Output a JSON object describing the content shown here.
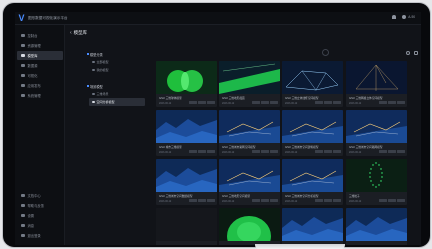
{
  "app": {
    "title": "图形数据可视化演示平台",
    "logo_glyph": "V",
    "user_name": "A-90"
  },
  "sidebar": {
    "items": [
      {
        "label": "控制台",
        "active": false
      },
      {
        "label": "资源管理",
        "active": false
      },
      {
        "label": "模型库",
        "active": true
      },
      {
        "label": "数据源",
        "active": false
      },
      {
        "label": "可视化",
        "active": false
      },
      {
        "label": "应用发布",
        "active": false
      },
      {
        "label": "系统管理",
        "active": false
      }
    ],
    "bottom_items": [
      {
        "label": "文档中心"
      },
      {
        "label": "帮助与反馈"
      },
      {
        "label": "设置"
      },
      {
        "label": "消息"
      },
      {
        "label": "退出登录"
      }
    ]
  },
  "page": {
    "title": "模型库",
    "back_glyph": "‹"
  },
  "categories": {
    "group1_title": "模型分类",
    "group1_items": [
      "全部模型",
      "我的模型"
    ],
    "group2_title": "场景模型",
    "group2_items": [
      {
        "label": "三维场景",
        "active": false
      },
      {
        "label": "空间分析模型",
        "active": true
      }
    ]
  },
  "cards": [
    {
      "title": "GSU 三维球体模型",
      "meta": "2023-06-12",
      "thumb": "green-spheres"
    },
    {
      "title": "GSU 三维地形截面",
      "meta": "2023-06-12",
      "thumb": "green-plane"
    },
    {
      "title": "GSU 三维立体线框空间模型",
      "meta": "2023-06-12",
      "thumb": "wire-box"
    },
    {
      "title": "GSU 三维网格立体空间模型",
      "meta": "2023-06-12",
      "thumb": "wire-star"
    },
    {
      "title": "GSU 城市三维模型",
      "meta": "2023-06-12",
      "thumb": "blue-terrain"
    },
    {
      "title": "GSU 三维城市路网空间模型",
      "meta": "2023-06-12",
      "thumb": "blue-lines"
    },
    {
      "title": "GSU 三维城市空间建筑模型",
      "meta": "2023-06-12",
      "thumb": "blue-lines"
    },
    {
      "title": "GSU 三维城市空间路网模型",
      "meta": "2023-06-12",
      "thumb": "blue-lines"
    },
    {
      "title": "GSU 三维城市空间数据模型",
      "meta": "2023-06-12",
      "thumb": "blue-terrain"
    },
    {
      "title": "GSU 三维地形空间模型",
      "meta": "2023-06-12",
      "thumb": "blue-lines"
    },
    {
      "title": "GSU 三维城市空间分析模型",
      "meta": "2023-06-12",
      "thumb": "blue-lines"
    },
    {
      "title": "三维粒子",
      "meta": "2023-06-12",
      "thumb": "green-dots"
    },
    {
      "title": "",
      "meta": "",
      "thumb": "dark"
    },
    {
      "title": "",
      "meta": "",
      "thumb": "green-dome"
    },
    {
      "title": "",
      "meta": "",
      "thumb": "blue-terrain"
    },
    {
      "title": "",
      "meta": "",
      "thumb": "blue-terrain"
    }
  ]
}
